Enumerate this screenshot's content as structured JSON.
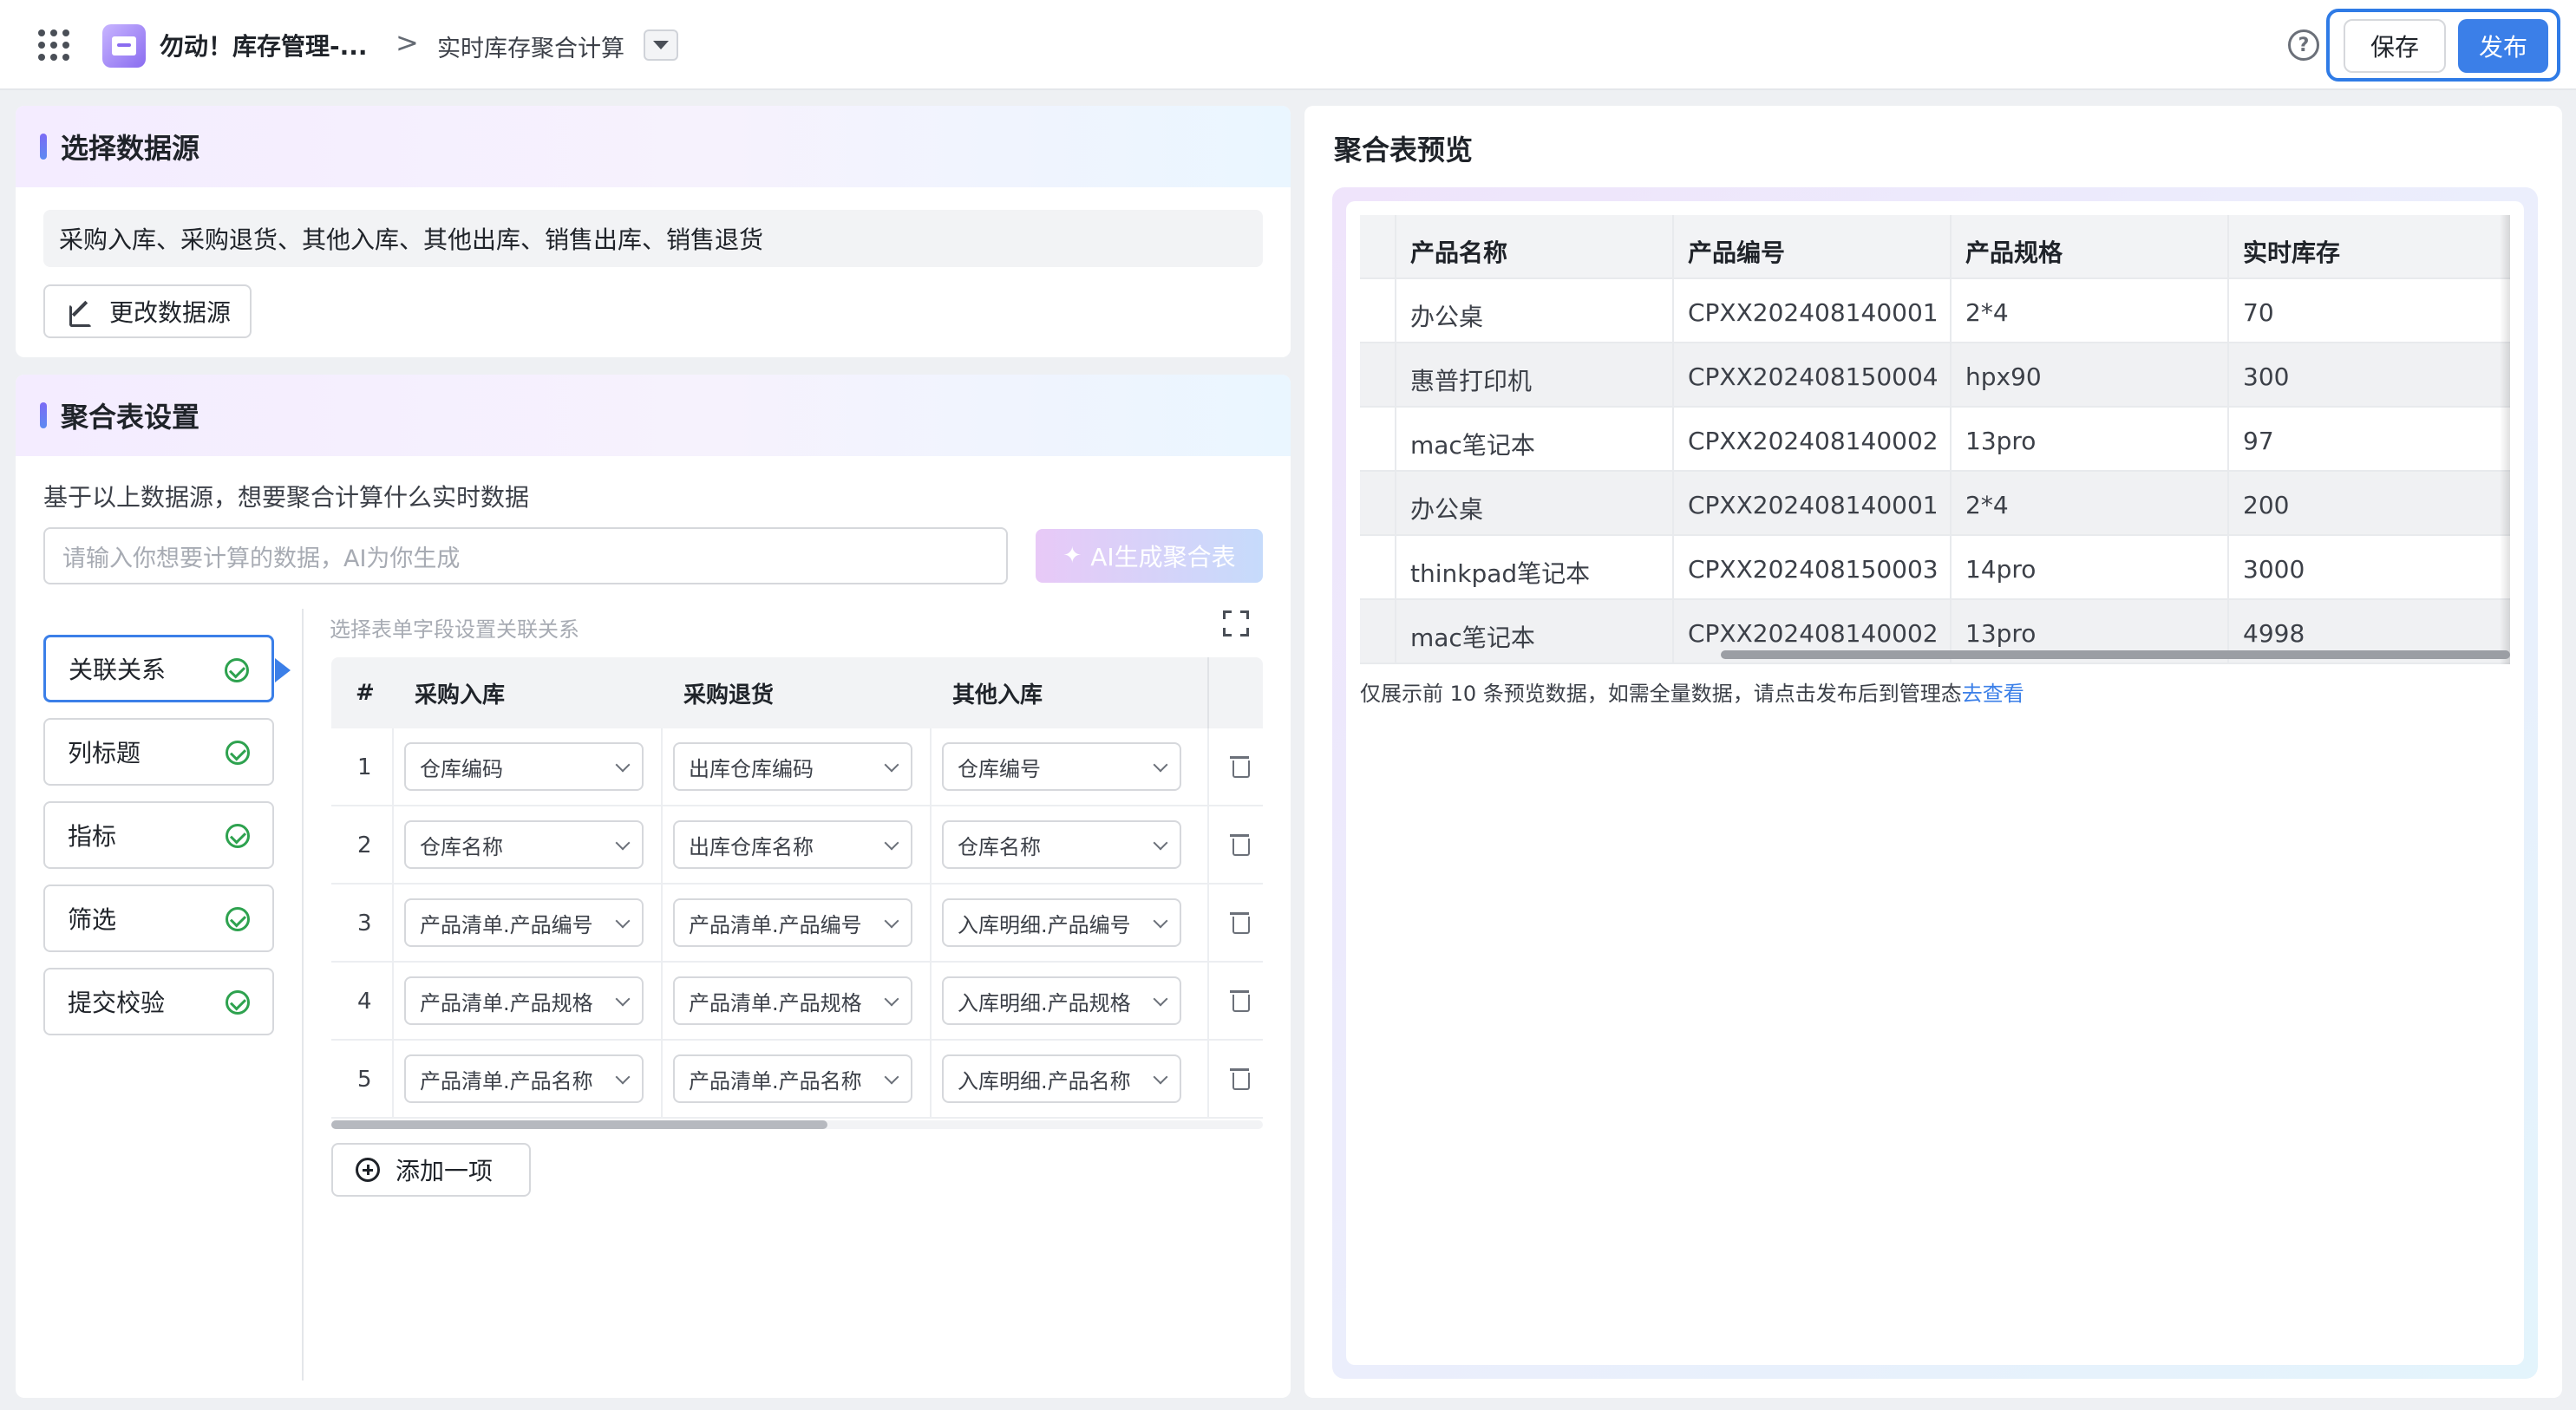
{
  "header": {
    "app_title": "勿动！库存管理-...",
    "breadcrumb_sep": ">",
    "page_title": "实时库存聚合计算",
    "help": "?",
    "save_label": "保存",
    "publish_label": "发布"
  },
  "source": {
    "section_title": "选择数据源",
    "selected": "采购入库、采购退货、其他入库、其他出库、销售出库、销售退货",
    "change_label": "更改数据源"
  },
  "aggregate": {
    "section_title": "聚合表设置",
    "description": "基于以上数据源，想要聚合计算什么实时数据",
    "input_placeholder": "请输入你想要计算的数据，AI为你生成",
    "ai_button": "AI生成聚合表",
    "tabs": [
      {
        "label": "关联关系"
      },
      {
        "label": "列标题"
      },
      {
        "label": "指标"
      },
      {
        "label": "筛选"
      },
      {
        "label": "提交校验"
      }
    ],
    "relation_hint": "选择表单字段设置关联关系",
    "table": {
      "columns": [
        "#",
        "采购入库",
        "采购退货",
        "其他入库"
      ],
      "rows": [
        {
          "num": "1",
          "c1": "仓库编码",
          "c2": "出库仓库编码",
          "c3": "仓库编号"
        },
        {
          "num": "2",
          "c1": "仓库名称",
          "c2": "出库仓库名称",
          "c3": "仓库名称"
        },
        {
          "num": "3",
          "c1": "产品清单.产品编号",
          "c2": "产品清单.产品编号",
          "c3": "入库明细.产品编号"
        },
        {
          "num": "4",
          "c1": "产品清单.产品规格",
          "c2": "产品清单.产品规格",
          "c3": "入库明细.产品规格"
        },
        {
          "num": "5",
          "c1": "产品清单.产品名称",
          "c2": "产品清单.产品名称",
          "c3": "入库明细.产品名称"
        }
      ]
    },
    "add_label": "添加一项"
  },
  "preview": {
    "title": "聚合表预览",
    "columns": [
      "产品名称",
      "产品编号",
      "产品规格",
      "实时库存"
    ],
    "rows": [
      {
        "name": "办公桌",
        "code": "CPXX202408140001",
        "spec": "2*4",
        "stock": "70"
      },
      {
        "name": "惠普打印机",
        "code": "CPXX202408150004",
        "spec": "hpx90",
        "stock": "300"
      },
      {
        "name": "mac笔记本",
        "code": "CPXX202408140002",
        "spec": "13pro",
        "stock": "97"
      },
      {
        "name": "办公桌",
        "code": "CPXX202408140001",
        "spec": "2*4",
        "stock": "200"
      },
      {
        "name": "thinkpad笔记本",
        "code": "CPXX202408150003",
        "spec": "14pro",
        "stock": "3000"
      },
      {
        "name": "mac笔记本",
        "code": "CPXX202408140002",
        "spec": "13pro",
        "stock": "4998"
      }
    ],
    "note": "仅展示前 10 条预览数据，如需全量数据，请点击发布后到管理态",
    "note_link": "去查看"
  },
  "colors": {
    "accent": "#3b7fe8",
    "check": "#2ea24f"
  }
}
